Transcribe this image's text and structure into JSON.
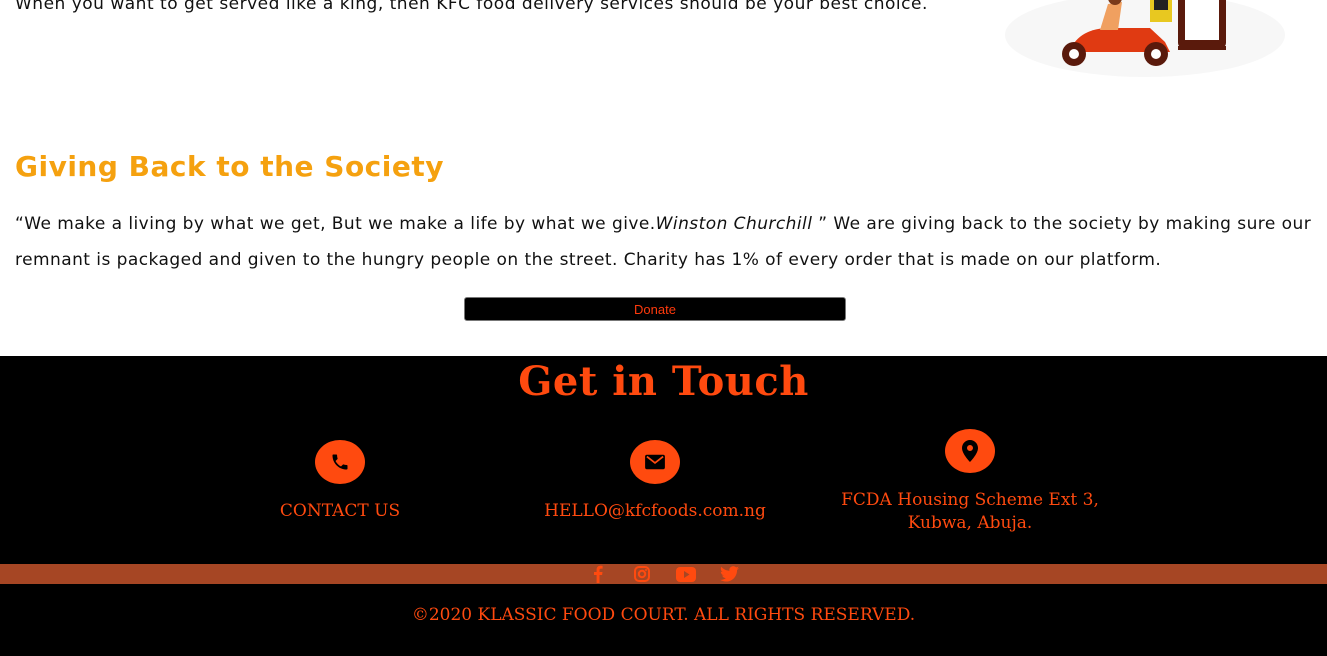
{
  "intro": {
    "text": "When you want to get served like a king, then KFC food delivery services should be your best choice."
  },
  "giving_back": {
    "title": "Giving Back to the Society",
    "quote_open": "“We make a living by what we get, But we make a life by what we give.",
    "quote_author": "Winston Churchill",
    "quote_close": " ” We are giving back to the society by making sure our remnant is packaged and given to the hungry people on the street. Charity has 1% of every order that is made on our platform.",
    "donate_label": "Donate"
  },
  "contact": {
    "title": "Get in Touch",
    "phone_label": "CONTACT US",
    "email_label": "HELLO@kfcfoods.com.ng",
    "address_line1": "FCDA Housing Scheme Ext 3,",
    "address_line2": "Kubwa, Abuja."
  },
  "social": {
    "icons": [
      "facebook-icon",
      "instagram-icon",
      "youtube-icon",
      "twitter-icon"
    ]
  },
  "footer": {
    "copyright": "©2020 KLASSIC FOOD COURT. ALL RIGHTS RESERVED."
  },
  "colors": {
    "accent": "#ff4a0f",
    "title_orange": "#f5a10f",
    "social_bar": "#a64624"
  }
}
